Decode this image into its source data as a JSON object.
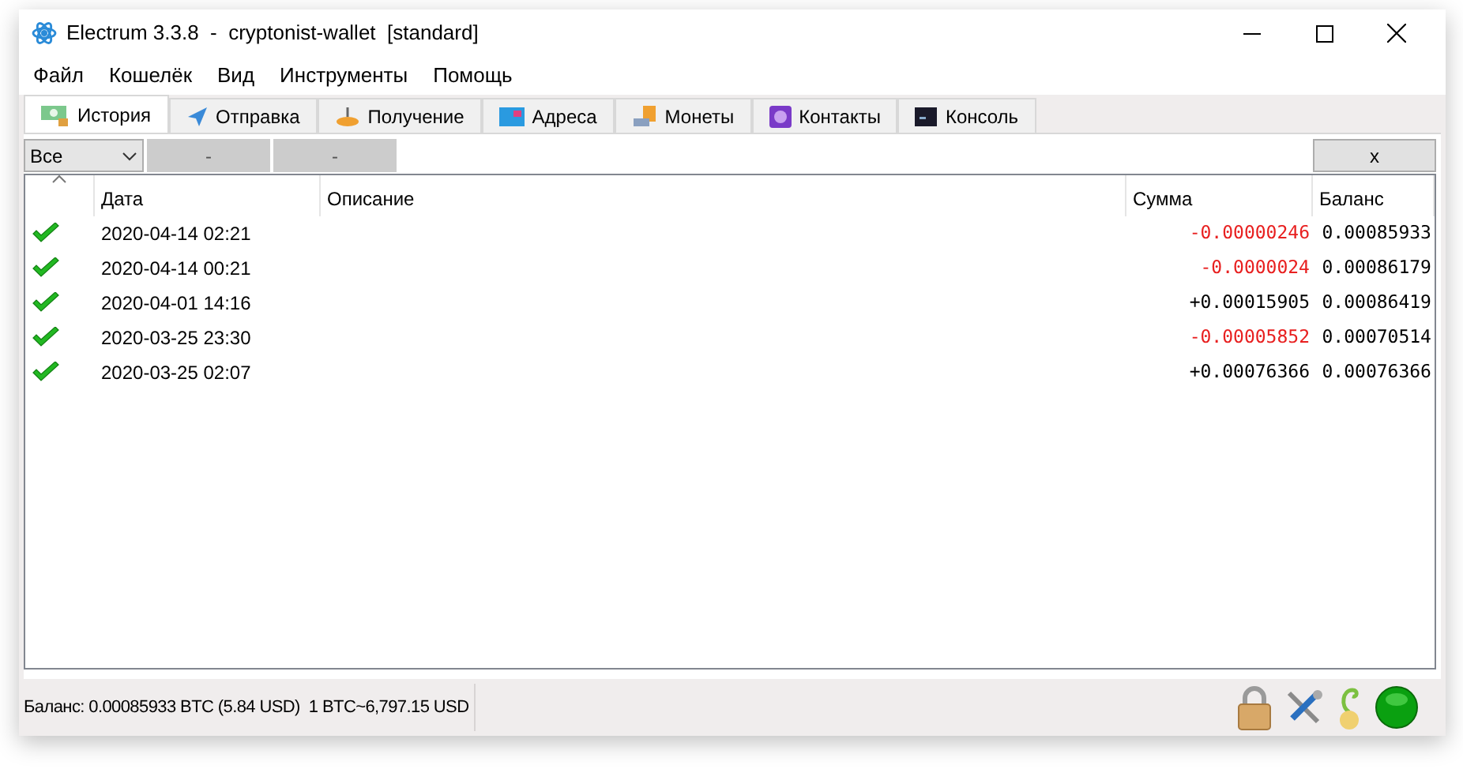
{
  "window": {
    "title": "Electrum 3.3.8  -  cryptonist-wallet  [standard]"
  },
  "menu": [
    "Файл",
    "Кошелёк",
    "Вид",
    "Инструменты",
    "Помощь"
  ],
  "tabs": [
    {
      "label": "История",
      "selected": true
    },
    {
      "label": "Отправка",
      "selected": false
    },
    {
      "label": "Получение",
      "selected": false
    },
    {
      "label": "Адреса",
      "selected": false
    },
    {
      "label": "Монеты",
      "selected": false
    },
    {
      "label": "Контакты",
      "selected": false
    },
    {
      "label": "Консоль",
      "selected": false
    }
  ],
  "toolbar": {
    "filter": "Все",
    "buttons": [
      "-",
      "-"
    ],
    "close_button": "x"
  },
  "table": {
    "columns": [
      "Дата",
      "Описание",
      "Сумма",
      "Баланс"
    ],
    "rows": [
      {
        "date": "2020-04-14 02:21",
        "amount": "-0.00000246",
        "negative": true,
        "balance": "0.00085933"
      },
      {
        "date": "2020-04-14 00:21",
        "amount": "-0.0000024",
        "negative": true,
        "balance": "0.00086179"
      },
      {
        "date": "2020-04-01 14:16",
        "amount": "+0.00015905",
        "negative": false,
        "balance": "0.00086419"
      },
      {
        "date": "2020-03-25 23:30",
        "amount": "-0.00005852",
        "negative": true,
        "balance": "0.00070514"
      },
      {
        "date": "2020-03-25 02:07",
        "amount": "+0.00076366",
        "negative": false,
        "balance": "0.00076366"
      }
    ]
  },
  "status_bar": {
    "balance": "Баланс: 0.00085933 BTC (5.84 USD)  1 BTC~6,797.15 USD"
  }
}
